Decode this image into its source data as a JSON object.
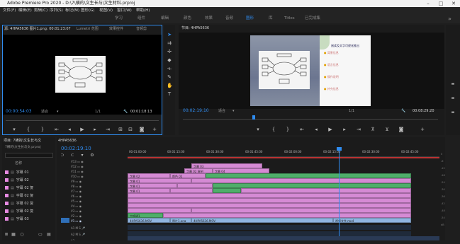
{
  "window": {
    "title": "Adobe Premiere Pro 2020 - D:\\7\\横的\\文生长与\\文生材料.prproj"
  },
  "menu": [
    "文件(F)",
    "编辑(E)",
    "剪辑(C)",
    "序列(S)",
    "标记(M)",
    "图形(G)",
    "视图(V)",
    "窗口(W)",
    "帮助(H)"
  ],
  "workspaces": [
    "学习",
    "组件",
    "编辑",
    "颜色",
    "效果",
    "音频",
    "图形",
    "库",
    "Titles",
    "已完成集"
  ],
  "source_monitor": {
    "tabs": [
      "源: 4HPA5636 图片1.png: 00:01:23:07",
      "Lumetri 范围",
      "效果控件",
      "音频剪"
    ],
    "timecode": "00:00:54:03",
    "fit": "适合",
    "fraction": "1/1",
    "duration": "00:01:18:13"
  },
  "program_monitor": {
    "tab": "节目: 4HPA5636",
    "timecode": "00:02:19:10",
    "fit": "适合",
    "fraction": "1/1",
    "duration": "00:08:29:20",
    "overlay_title": "阅读及文字可视化推出",
    "overlay_sections": [
      "背景信息",
      "语言信息",
      "操作说明",
      "补充信息"
    ]
  },
  "project": {
    "tab": "项目: 7横的\\文生长与文",
    "file": "7横的\\文生长与文.prproj",
    "column": "名称",
    "items": [
      "字幕 01",
      "字幕 02",
      "字幕 02 复",
      "字幕 02 复",
      "字幕 02 复",
      "字幕 02 复",
      "字幕 03"
    ]
  },
  "timeline": {
    "tab": "4HPA5636",
    "timecode": "00:02:19:10",
    "ruler": [
      "00:01:00:00",
      "00:01:15:00",
      "00:01:30:00",
      "00:01:45:00",
      "00:02:00:00",
      "00:02:15:00",
      "00:02:30:00",
      "00:02:45:00"
    ],
    "tracks": [
      "V13",
      "V12",
      "V11",
      "V10",
      "V9",
      "V8",
      "V7",
      "V6",
      "V5",
      "V4",
      "V3",
      "V2",
      "V1",
      "A1",
      "A2",
      "A3"
    ],
    "clip_labels": {
      "v12": "字幕 03",
      "v11a": "字幕 02 复制",
      "v11b": "字幕 04",
      "v10a": "字幕 02",
      "v10b": "颜色 02",
      "v9": "字幕 01",
      "v8": "字幕 01",
      "v7": "字幕 01",
      "v2": "空格键1",
      "v1a": "4HPA5636.MOV",
      "v1b": "图片1.png",
      "v1c": "4HPA5636.MOV",
      "v1d": "视频文件.mp4"
    },
    "db_scale": [
      "0",
      "-6",
      "-12",
      "-18",
      "-24",
      "-30",
      "-36",
      "-42",
      "-48",
      "-54",
      "dB"
    ]
  },
  "colors": {
    "accent": "#2f8cf0",
    "clip_pink": "#d58ad4",
    "clip_green": "#4fae6a",
    "clip_blue": "#8fb4e0",
    "playhead": "#2f8cf0"
  }
}
